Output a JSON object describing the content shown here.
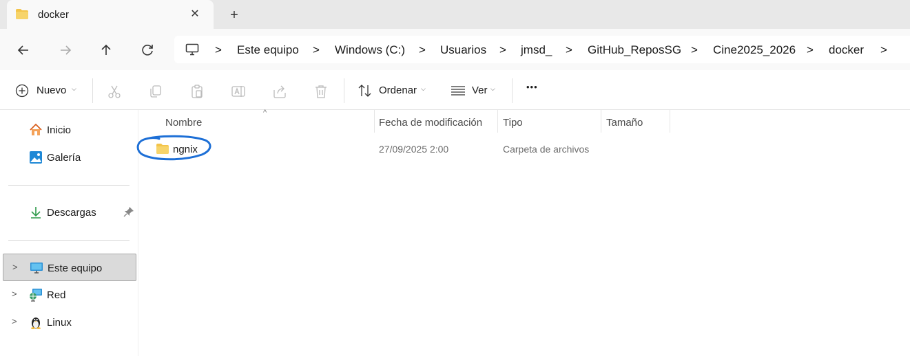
{
  "tab": {
    "title": "docker",
    "close": "✕",
    "new_tab": "+"
  },
  "nav": {
    "back_icon": "arrow-left-icon",
    "forward_icon": "arrow-right-icon",
    "up_icon": "arrow-up-icon",
    "refresh_icon": "refresh-icon"
  },
  "breadcrumb": [
    "Este equipo",
    "Windows (C:)",
    "Usuarios",
    "jmsd_",
    "GitHub_ReposSG",
    "Cine2025_2026",
    "docker"
  ],
  "breadcrumb_separator": ">",
  "toolbar": {
    "new_label": "Nuevo",
    "sort_label": "Ordenar",
    "view_label": "Ver",
    "more_label": "•••"
  },
  "sidebar": {
    "items": [
      {
        "label": "Inicio",
        "icon": "home-icon"
      },
      {
        "label": "Galería",
        "icon": "gallery-icon"
      },
      {
        "label": "Descargas",
        "icon": "download-icon"
      },
      {
        "label": "Este equipo",
        "icon": "computer-icon"
      },
      {
        "label": "Red",
        "icon": "network-icon"
      },
      {
        "label": "Linux",
        "icon": "linux-icon"
      }
    ],
    "expand_glyph": ">"
  },
  "columns": [
    "Nombre",
    "Fecha de modificación",
    "Tipo",
    "Tamaño"
  ],
  "sort_glyph": "^",
  "files": [
    {
      "name": "ngnix",
      "modified": "27/09/2025 2:00",
      "type": "Carpeta de archivos",
      "size": ""
    }
  ],
  "colors": {
    "folder": "#f3c44a",
    "annotation": "#1d6fd6",
    "selected_bg": "#dadada"
  }
}
